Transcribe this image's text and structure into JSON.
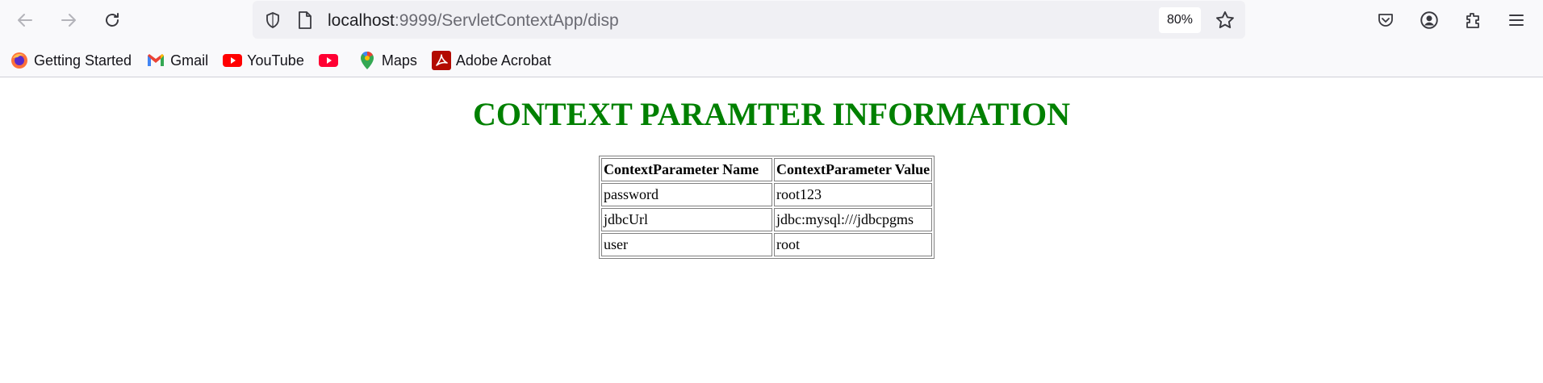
{
  "browser": {
    "url_host": "localhost",
    "url_path": ":9999/ServletContextApp/disp",
    "zoom": "80%",
    "bookmarks": [
      {
        "label": "Getting Started",
        "icon": "firefox-icon"
      },
      {
        "label": "Gmail",
        "icon": "gmail-icon"
      },
      {
        "label": "YouTube",
        "icon": "youtube-icon"
      },
      {
        "label": "",
        "icon": "youtube-icon"
      },
      {
        "label": "Maps",
        "icon": "maps-icon"
      },
      {
        "label": "Adobe Acrobat",
        "icon": "adobe-acrobat-icon"
      }
    ]
  },
  "page": {
    "title": "CONTEXT PARAMTER INFORMATION",
    "title_color": "#008000",
    "table": {
      "headers": [
        "ContextParameter Name",
        "ContextParameter Value"
      ],
      "rows": [
        [
          "password",
          "root123"
        ],
        [
          "jdbcUrl",
          "jdbc:mysql:///jdbcpgms"
        ],
        [
          "user",
          "root"
        ]
      ]
    }
  }
}
